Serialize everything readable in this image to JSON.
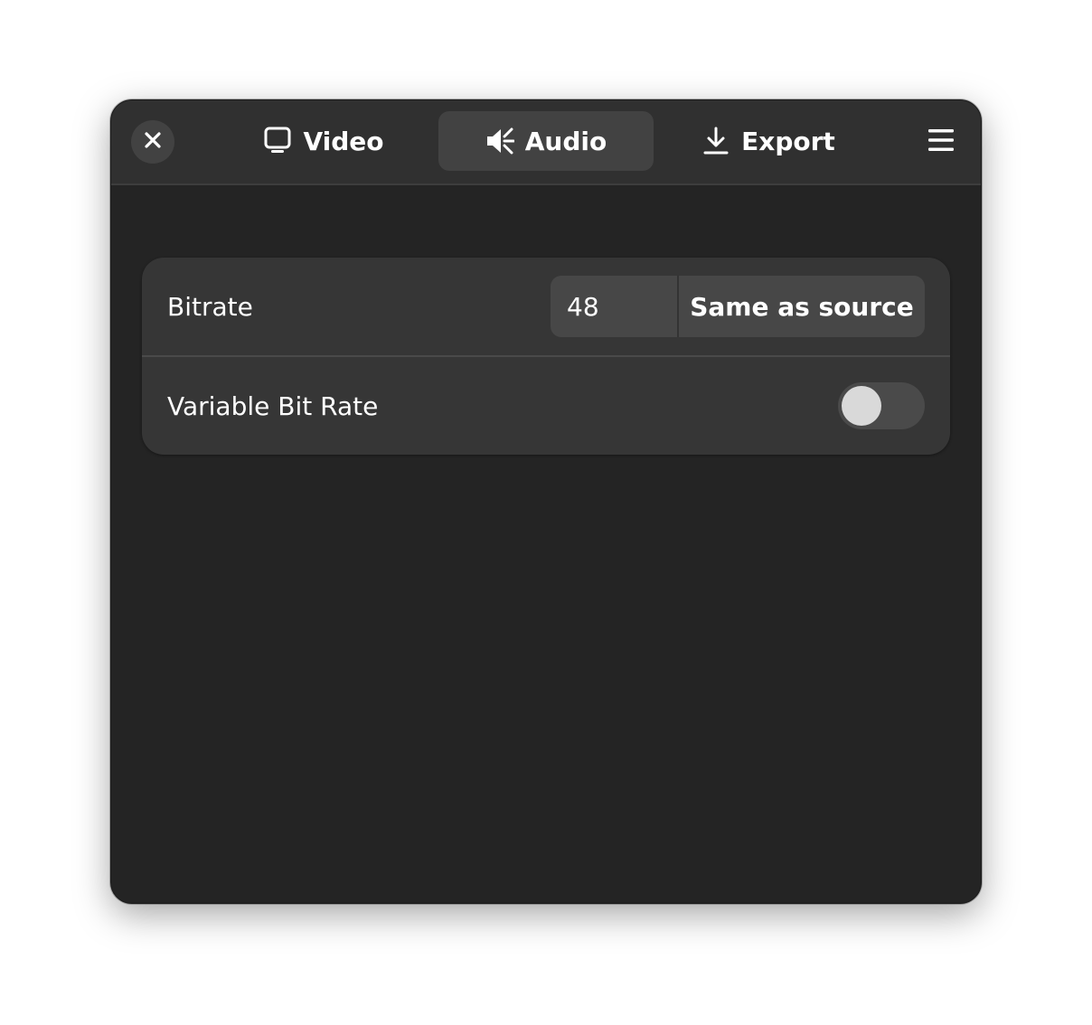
{
  "header": {
    "close_icon": "close-icon",
    "tabs": [
      {
        "label": "Video",
        "icon": "monitor-icon",
        "active": false
      },
      {
        "label": "Audio",
        "icon": "speaker-icon",
        "active": true
      },
      {
        "label": "Export",
        "icon": "download-icon",
        "active": false
      }
    ],
    "menu_icon": "hamburger-menu-icon"
  },
  "settings": {
    "bitrate": {
      "label": "Bitrate",
      "value": "48",
      "same_as_source_label": "Same as source"
    },
    "variable_bit_rate": {
      "label": "Variable Bit Rate",
      "enabled": false
    }
  },
  "colors": {
    "window_bg": "#242424",
    "header_bg": "#303030",
    "card_bg": "#363636",
    "button_bg": "#474747",
    "text": "#ffffff"
  }
}
